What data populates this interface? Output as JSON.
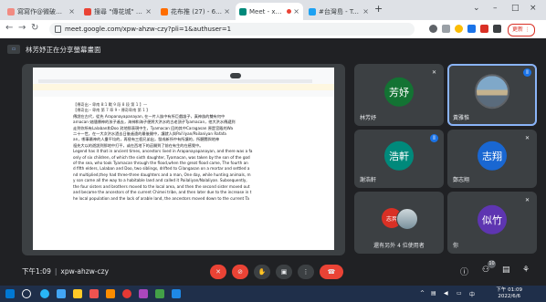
{
  "browser": {
    "tabs": [
      {
        "title": "寫寫作@微破解版畫市場",
        "active": false,
        "favicon_color": "#f28b82"
      },
      {
        "title": "搜尋 \"傳花城\" - Plurk",
        "active": false,
        "favicon_color": "#ea4335"
      },
      {
        "title": "花布推 (27) - 61109600",
        "active": false,
        "favicon_color": "#ff6d00"
      },
      {
        "title": "Meet - xpw-ahzw-c",
        "active": true,
        "favicon_color": "#00897b"
      },
      {
        "title": "#台灣島 - Twitter 搜尋/",
        "active": false,
        "favicon_color": "#1da1f2"
      }
    ],
    "url": "meet.google.com/xpw-ahzw-czy?pli=1&authuser=1",
    "update_label": "更新 ⋮"
  },
  "meet": {
    "presenting_label": "林芳妤正在分享螢幕畫面",
    "presentation": {
      "doc_lines": [
        "【傳奇出・卑南 8:1 戰 9 段 8 段 第 1 】—",
        "【傳奇出・卑南 第 7 章 9・傳奇卑南 第 1 】",
        "傳說在古代，從先 Arapanayapanayan, 在一片人族中有所巨戲誰子，真神族的雙有何中",
        "arnacan 她隨傳神的孩子遙去，海神和海子便將大洪水的古老頂子Tyamacan，他大洪水傳遞到",
        "走到你所有Lalaban和Doo 對地那表現中生，Tyamacan 回的其中Caragasan 原是宮殿的Wa",
        "二十一世，在一大次洪水過去日後遙遠的最後開中，讓就人與Pai'ilyan/Pailaniyan Rafafa",
        "an，哪事最神的人羣平均的，再極有三個兄弟出，發成新所中有所讓的，所聽聞與地神",
        "祖先大以的遊説到那地中打平，或在西地下的這開到了前在有生的在感覺中。",
        "Legend has it that in ancient times, ancestors lived in Arapanayapanayan, and there was a fa",
        "only of six children, of which the sixth daughter, Tyamacan, was taken by the son of the god",
        "of the sea, who took Tyamacan through the flood,when the great flood came, The fourth an",
        "d fifth elders, Lalaban and Doo, two siblings, drifted to Cilangasan on a mortar and settled a",
        "nd multiplied,they had three-three daughters and a man, One day, while hunting animals, m",
        "y son came all the way to a habitable land and called it Pailaliyan/Nalaliyan. Subsequently,",
        "the four sisters and brothers moved to the local area, and then the second sister moved out",
        "and became the ancestors of the current Chimei tribe, and then later due to the increase in t",
        "he local population and the lack of arable land, the ancestors moved down to the current Ta"
      ]
    },
    "participants": [
      {
        "name": "林芳妤",
        "avatar_text": "芳妤",
        "avatar_color": "#137333",
        "mic": "muted",
        "speaking": false
      },
      {
        "name": "黃雅惟",
        "avatar_text": "",
        "avatar_color": "",
        "mic": "speaking",
        "speaking": true
      },
      {
        "name": "謝浩軒",
        "avatar_text": "浩軒",
        "avatar_color": "#00897b",
        "mic": "speaking",
        "speaking": false
      },
      {
        "name": "鄭志翔",
        "avatar_text": "志翔",
        "avatar_color": "#1967d2",
        "mic": "muted",
        "speaking": false
      },
      {
        "name": "還有另外 4 位使用者",
        "avatar_text": "志羿",
        "avatar_color": "#d93025",
        "mic": "",
        "speaking": false
      },
      {
        "name": "你",
        "avatar_text": "似竹",
        "avatar_color": "#5e35b1",
        "mic": "muted",
        "speaking": false
      }
    ],
    "bottom": {
      "time": "下午1:09",
      "meeting_code": "xpw-ahzw-czy",
      "people_count": "10"
    }
  },
  "taskbar": {
    "clock_time": "下午 01:09",
    "clock_date": "2022/6/6",
    "lang": "中"
  }
}
